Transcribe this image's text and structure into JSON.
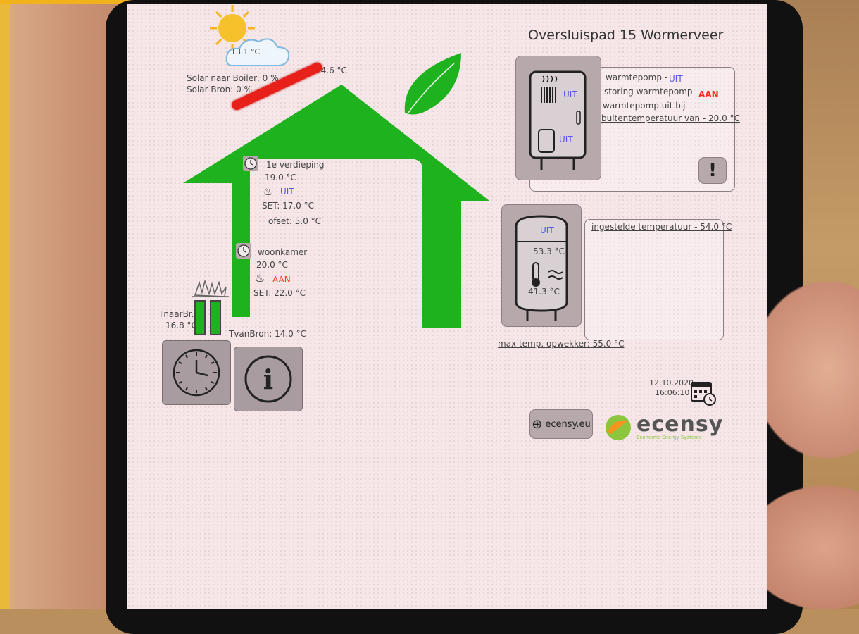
{
  "address": "Oversluispad 15 Wormerveer",
  "weather": {
    "temp": "13.1 °C",
    "icon": "sun-cloud-icon"
  },
  "solar": {
    "boiler": "Solar naar Boiler: 0 %",
    "bron": "Solar Bron: 0 %",
    "panel_temp": "14.6 °C"
  },
  "zones": [
    {
      "name": "1e verdieping",
      "temp": "19.0 °C",
      "heat_state": "UIT",
      "set": "SET: 17.0 °C",
      "offset": "ofset: 5.0 °C"
    },
    {
      "name": "woonkamer",
      "temp": "20.0 °C",
      "heat_state": "AAN",
      "set": "SET: 22.0 °C"
    }
  ],
  "ground": {
    "tnaar_label": "TnaarBr.",
    "tnaar_value": "16.8 °C",
    "tvan": "TvanBron: 14.0 °C"
  },
  "heatpump": {
    "line1_label": "warmtepomp -",
    "line1_state": "UIT",
    "line2_label": "storing warmtepomp -",
    "line2_state": "AAN",
    "line3": "warmtepomp uit bij",
    "line4": "buitentemperatuur van - 20.0 °C",
    "badge_top": "UIT",
    "badge_bottom": "UIT"
  },
  "boiler": {
    "badge": "UIT",
    "top_temp": "53.3 °C",
    "bottom_temp": "41.3 °C",
    "setpoint": "ingestelde temperatuur - 54.0 °C",
    "max_temp": "max temp. opwekker: 55.0 °C"
  },
  "datetime": {
    "date": "12.10.2020",
    "time": "16:06:10"
  },
  "links": {
    "website": "ecensy.eu"
  },
  "brand": {
    "name": "ecensy",
    "tagline": "Economic Energy Systems"
  },
  "colors": {
    "house_green": "#1fb21f",
    "uit_blue": "#5657ee",
    "aan_red": "#ff3b2b",
    "heater_red": "#e8201a"
  }
}
